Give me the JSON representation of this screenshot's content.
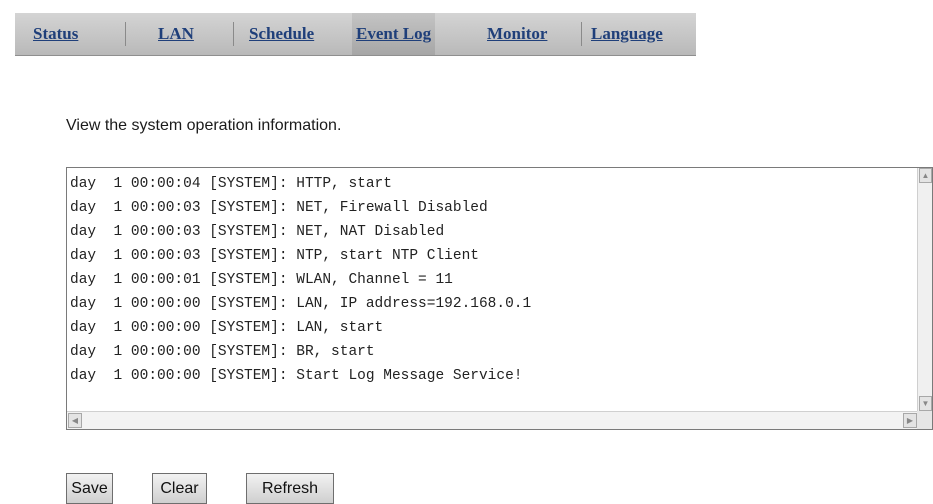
{
  "tabs": [
    {
      "label": "Status"
    },
    {
      "label": "LAN"
    },
    {
      "label": "Schedule"
    },
    {
      "label": "Event Log",
      "active": true
    },
    {
      "label": "Monitor"
    },
    {
      "label": "Language"
    }
  ],
  "description": "View the system operation information.",
  "log": {
    "lines": [
      "day  1 00:00:04 [SYSTEM]: HTTP, start",
      "day  1 00:00:03 [SYSTEM]: NET, Firewall Disabled",
      "day  1 00:00:03 [SYSTEM]: NET, NAT Disabled",
      "day  1 00:00:03 [SYSTEM]: NTP, start NTP Client",
      "day  1 00:00:01 [SYSTEM]: WLAN, Channel = 11",
      "day  1 00:00:00 [SYSTEM]: LAN, IP address=192.168.0.1",
      "day  1 00:00:00 [SYSTEM]: LAN, start",
      "day  1 00:00:00 [SYSTEM]: BR, start",
      "day  1 00:00:00 [SYSTEM]: Start Log Message Service!"
    ]
  },
  "buttons": {
    "save": "Save",
    "clear": "Clear",
    "refresh": "Refresh"
  },
  "icons": {
    "scroll_up": "arrow-up-icon",
    "scroll_down": "arrow-down-icon",
    "scroll_left": "arrow-left-icon",
    "scroll_right": "arrow-right-icon"
  },
  "colors": {
    "tab_text": "#1f3f7a",
    "tabbar_bg": "#c8c8c8"
  }
}
